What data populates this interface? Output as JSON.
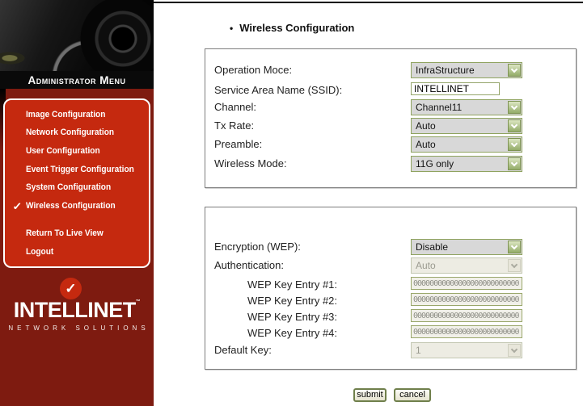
{
  "sidebar": {
    "admin_title": "Administrator Menu",
    "active_check": "✓",
    "menu": [
      {
        "label": "Image Configuration"
      },
      {
        "label": "Network Configuration"
      },
      {
        "label": "User Configuration"
      },
      {
        "label": "Event Trigger Configuration"
      },
      {
        "label": "System Configuration"
      },
      {
        "label": "Wireless Configuration",
        "active": true
      },
      {
        "label": "Return To Live View"
      },
      {
        "label": "Logout"
      }
    ],
    "logo": {
      "check": "✓",
      "name": "INTELLINET",
      "trademark": "™",
      "tagline": "NETWORK SOLUTIONS"
    }
  },
  "main": {
    "heading_bullet": "•",
    "heading": "Wireless Configuration",
    "wireless": {
      "rows": [
        {
          "label": "Operation Moce:",
          "type": "select",
          "value": "InfraStructure",
          "disabled": false
        },
        {
          "label": "Service Area Name (SSID):",
          "type": "text",
          "value": "INTELLINET",
          "disabled": false
        },
        {
          "label": "Channel:",
          "type": "select",
          "value": "Channel11",
          "disabled": false
        },
        {
          "label": "Tx Rate:",
          "type": "select",
          "value": "Auto",
          "disabled": false
        },
        {
          "label": "Preamble:",
          "type": "select",
          "value": "Auto",
          "disabled": false
        },
        {
          "label": "Wireless Mode:",
          "type": "select",
          "value": "11G only",
          "disabled": false
        }
      ]
    },
    "security": {
      "rows": [
        {
          "label": "Encryption (WEP):",
          "type": "select",
          "value": "Disable",
          "disabled": false
        },
        {
          "label": "Authentication:",
          "type": "select",
          "value": "Auto",
          "disabled": true
        },
        {
          "label": "WEP Key Entry #1:",
          "type": "text",
          "value": "00000000000000000000000000",
          "disabled": true
        },
        {
          "label": "WEP Key Entry #2:",
          "type": "text",
          "value": "00000000000000000000000000",
          "disabled": true
        },
        {
          "label": "WEP Key Entry #3:",
          "type": "text",
          "value": "00000000000000000000000000",
          "disabled": true
        },
        {
          "label": "WEP Key Entry #4:",
          "type": "text",
          "value": "00000000000000000000000000",
          "disabled": true
        },
        {
          "label": "Default Key:",
          "type": "select",
          "value": "1",
          "disabled": true
        }
      ]
    },
    "actions": {
      "submit": "submit",
      "cancel": "cancel"
    }
  },
  "colors": {
    "sidebar_bg": "#7E1B10",
    "menu_panel_red": "#C5290F",
    "olive_border": "#8FA35F",
    "select_body": "#D8D8D8",
    "disabled_body": "#EDECE3",
    "box_border": "#7D7D7D"
  }
}
